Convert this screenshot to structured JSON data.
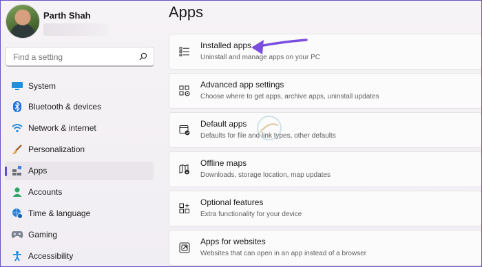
{
  "user": {
    "name": "Parth Shah"
  },
  "search": {
    "placeholder": "Find a setting"
  },
  "sidebar": {
    "items": [
      {
        "label": "System",
        "icon": "monitor-icon"
      },
      {
        "label": "Bluetooth & devices",
        "icon": "bluetooth-icon"
      },
      {
        "label": "Network & internet",
        "icon": "wifi-icon"
      },
      {
        "label": "Personalization",
        "icon": "brush-icon"
      },
      {
        "label": "Apps",
        "icon": "apps-icon",
        "active": true
      },
      {
        "label": "Accounts",
        "icon": "person-icon"
      },
      {
        "label": "Time & language",
        "icon": "globe-clock-icon"
      },
      {
        "label": "Gaming",
        "icon": "gamepad-icon"
      },
      {
        "label": "Accessibility",
        "icon": "accessibility-icon"
      }
    ]
  },
  "main": {
    "title": "Apps",
    "cards": [
      {
        "title": "Installed apps",
        "subtitle": "Uninstall and manage apps on your PC",
        "icon": "list-icon"
      },
      {
        "title": "Advanced app settings",
        "subtitle": "Choose where to get apps, archive apps, uninstall updates",
        "icon": "app-settings-icon"
      },
      {
        "title": "Default apps",
        "subtitle": "Defaults for file and link types, other defaults",
        "icon": "default-apps-icon"
      },
      {
        "title": "Offline maps",
        "subtitle": "Downloads, storage location, map updates",
        "icon": "map-download-icon"
      },
      {
        "title": "Optional features",
        "subtitle": "Extra functionality for your device",
        "icon": "optional-features-icon"
      },
      {
        "title": "Apps for websites",
        "subtitle": "Websites that can open in an app instead of a browser",
        "icon": "open-in-app-icon"
      }
    ]
  },
  "colors": {
    "accent": "#5a4fcf",
    "arrow": "#7a4fe0"
  }
}
